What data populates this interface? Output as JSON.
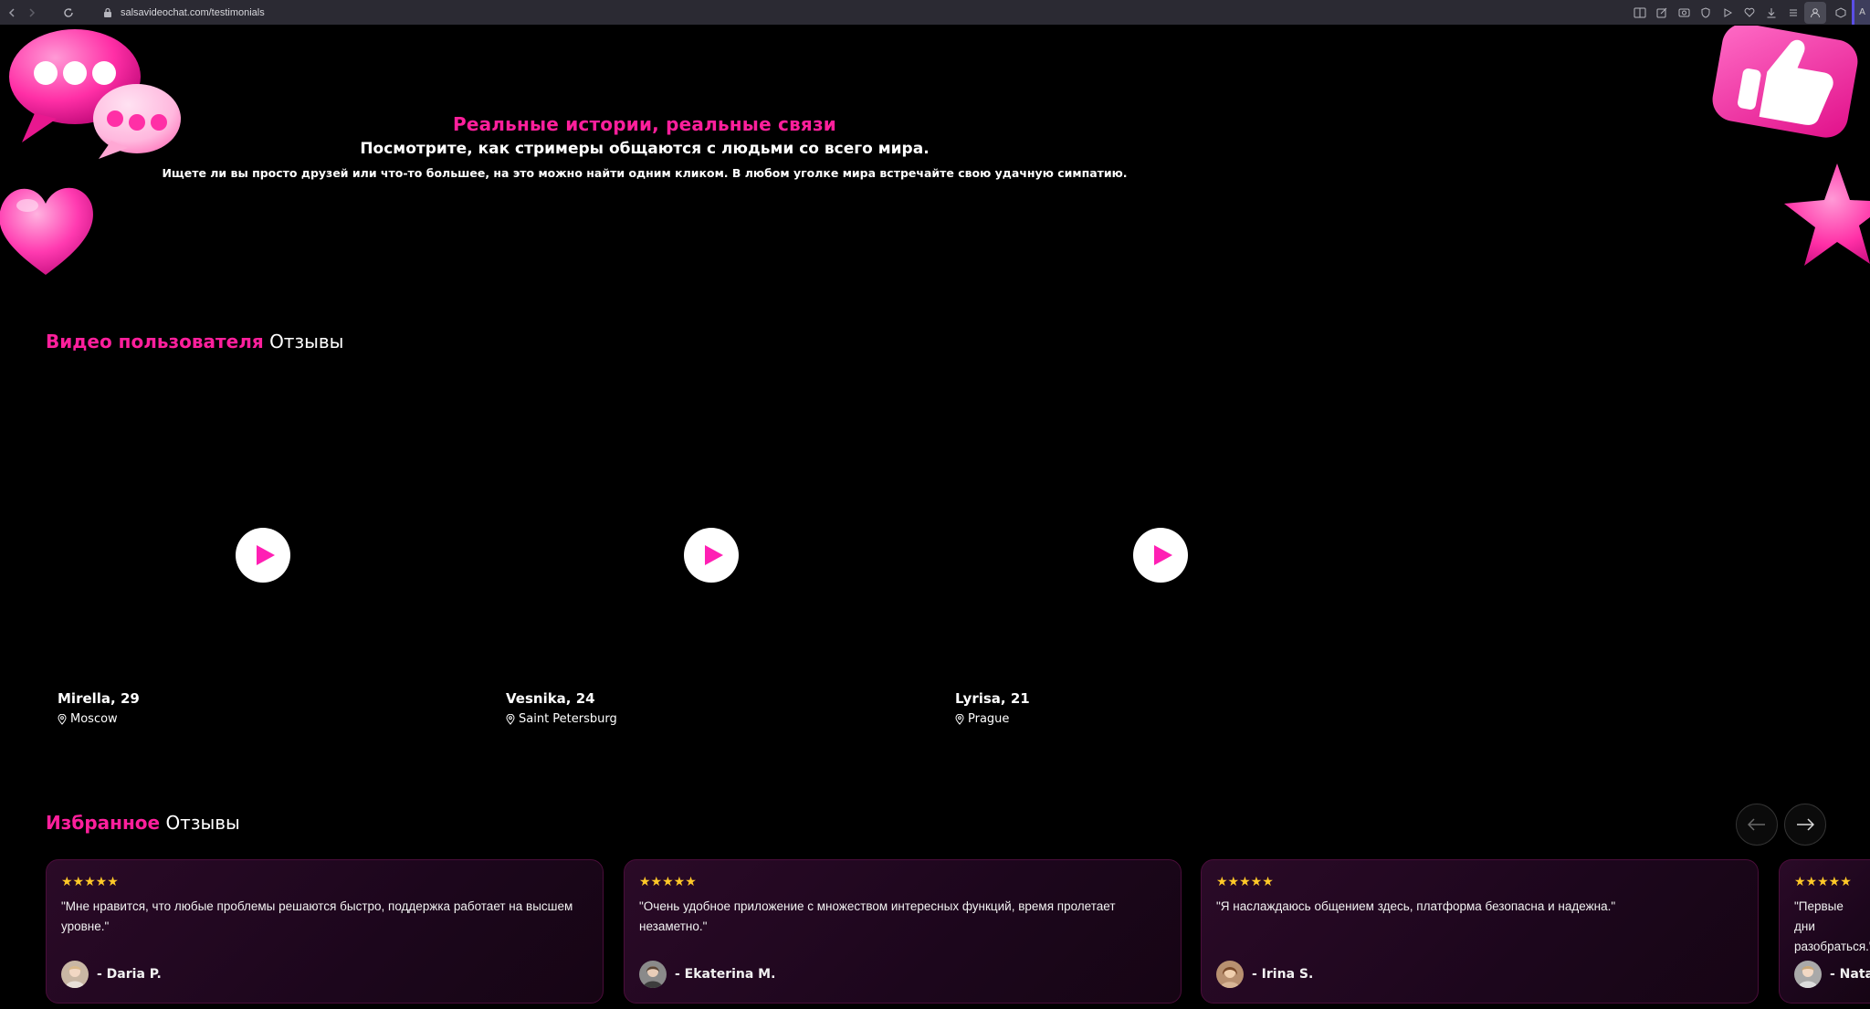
{
  "browser": {
    "url": "salsavideochat.com/testimonials",
    "edge_label": "A"
  },
  "hero": {
    "title": "Реальные истории, реальные связи",
    "subtitle": "Посмотрите, как стримеры общаются с людьми со всего мира.",
    "description": "Ищете ли вы просто друзей или что-то большее, на это можно найти одним кликом. В любом уголке мира встречайте свою удачную симпатию."
  },
  "video_section": {
    "title_pink": "Видео пользователя",
    "title_white": "Отзывы",
    "videos": [
      {
        "name": "Mirella, 29",
        "location": "Moscow"
      },
      {
        "name": "Vesnika, 24",
        "location": "Saint Petersburg"
      },
      {
        "name": "Lyrisa, 21",
        "location": "Prague"
      }
    ]
  },
  "reviews_section": {
    "title_pink": "Избранное",
    "title_white": "Отзывы",
    "reviews": [
      {
        "stars": "★★★★★",
        "text": "\"Мне нравится, что любые проблемы решаются быстро, поддержка работает на высшем уровне.\"",
        "author": "- Daria P."
      },
      {
        "stars": "★★★★★",
        "text": "\"Очень удобное приложение с множеством интересных функций, время пролетает незаметно.\"",
        "author": "- Ekaterina M."
      },
      {
        "stars": "★★★★★",
        "text": "\"Я наслаждаюсь общением здесь, платформа безопасна и надежна.\"",
        "author": "- Irina S."
      },
      {
        "stars": "★★★★★",
        "text": "\"Первые дни разобраться.\"",
        "author": "- Natal"
      }
    ]
  },
  "colors": {
    "accent": "#ff1f9c",
    "star": "#ffc928",
    "background": "#000000"
  }
}
